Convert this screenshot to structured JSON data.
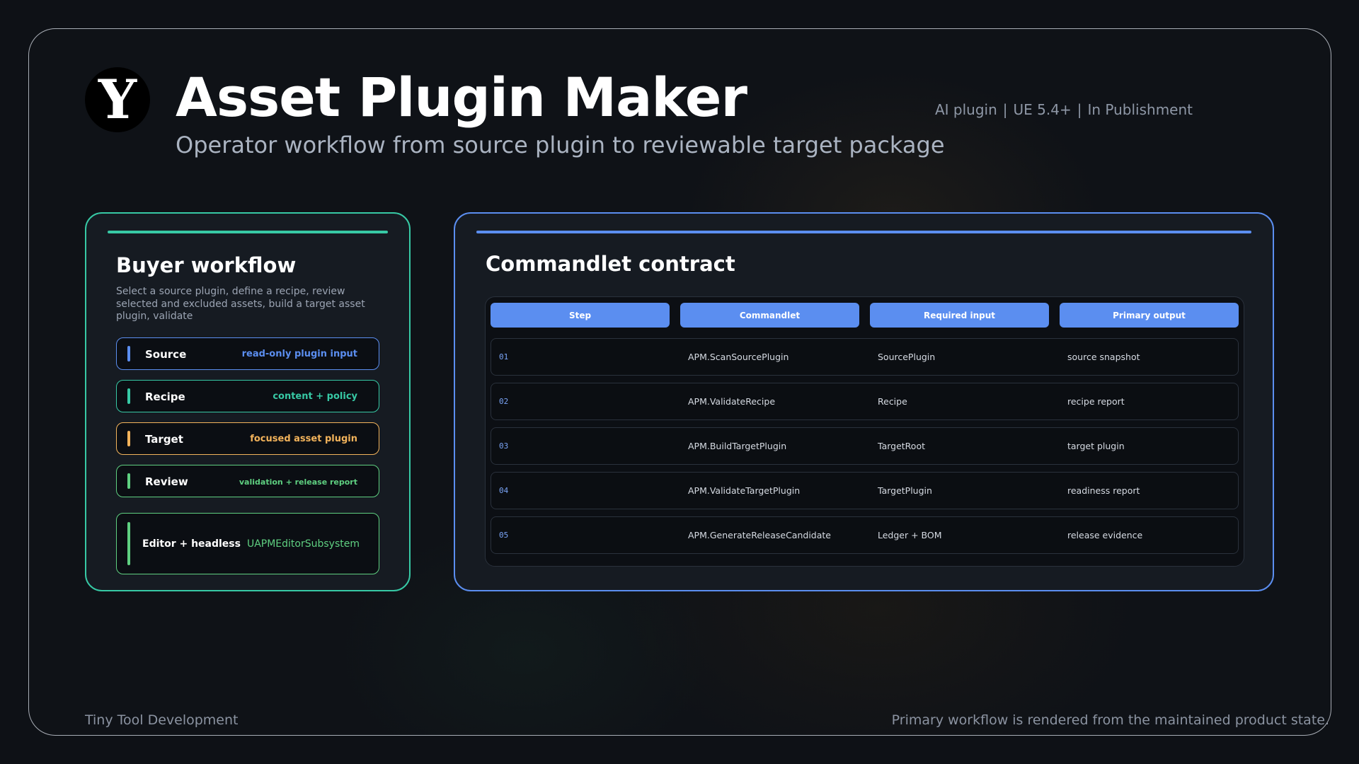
{
  "header": {
    "logo_letter": "Y",
    "title": "Asset Plugin Maker",
    "subtitle": "Operator workflow from source plugin to reviewable target package",
    "meta": [
      "AI plugin",
      "UE 5.4+",
      "In Publishment"
    ],
    "meta_separator": "|"
  },
  "workflow": {
    "heading": "Buyer workflow",
    "description": "Select a source plugin, define a recipe, review selected and excluded assets, build a target asset plugin, validate",
    "steps": [
      {
        "label": "Source",
        "value": "read-only plugin input",
        "color": "#5b8ef0"
      },
      {
        "label": "Recipe",
        "value": "content + policy",
        "color": "#37c9a5"
      },
      {
        "label": "Target",
        "value": "focused asset plugin",
        "color": "#f2b35b"
      },
      {
        "label": "Review",
        "value": "validation + release report",
        "color": "#5fd081"
      },
      {
        "label": "Editor + headless",
        "value": "UAPMEditorSubsystem",
        "color": "#5fd081"
      }
    ]
  },
  "contract": {
    "heading": "Commandlet contract",
    "columns": [
      "Step",
      "Commandlet",
      "Required input",
      "Primary output"
    ],
    "rows": [
      {
        "step": "01",
        "commandlet": "APM.ScanSourcePlugin",
        "input": "SourcePlugin",
        "output": "source snapshot"
      },
      {
        "step": "02",
        "commandlet": "APM.ValidateRecipe",
        "input": "Recipe",
        "output": "recipe report"
      },
      {
        "step": "03",
        "commandlet": "APM.BuildTargetPlugin",
        "input": "TargetRoot",
        "output": "target plugin"
      },
      {
        "step": "04",
        "commandlet": "APM.ValidateTargetPlugin",
        "input": "TargetPlugin",
        "output": "readiness report"
      },
      {
        "step": "05",
        "commandlet": "APM.GenerateReleaseCandidate",
        "input": "Ledger + BOM",
        "output": "release evidence"
      }
    ]
  },
  "footer": {
    "left": "Tiny Tool Development",
    "right": "Primary workflow is rendered from the maintained product state."
  },
  "colors": {
    "accent_teal": "#37c9a5",
    "accent_blue": "#5b8ef0",
    "accent_orange": "#f2b35b",
    "accent_green": "#5fd081"
  }
}
